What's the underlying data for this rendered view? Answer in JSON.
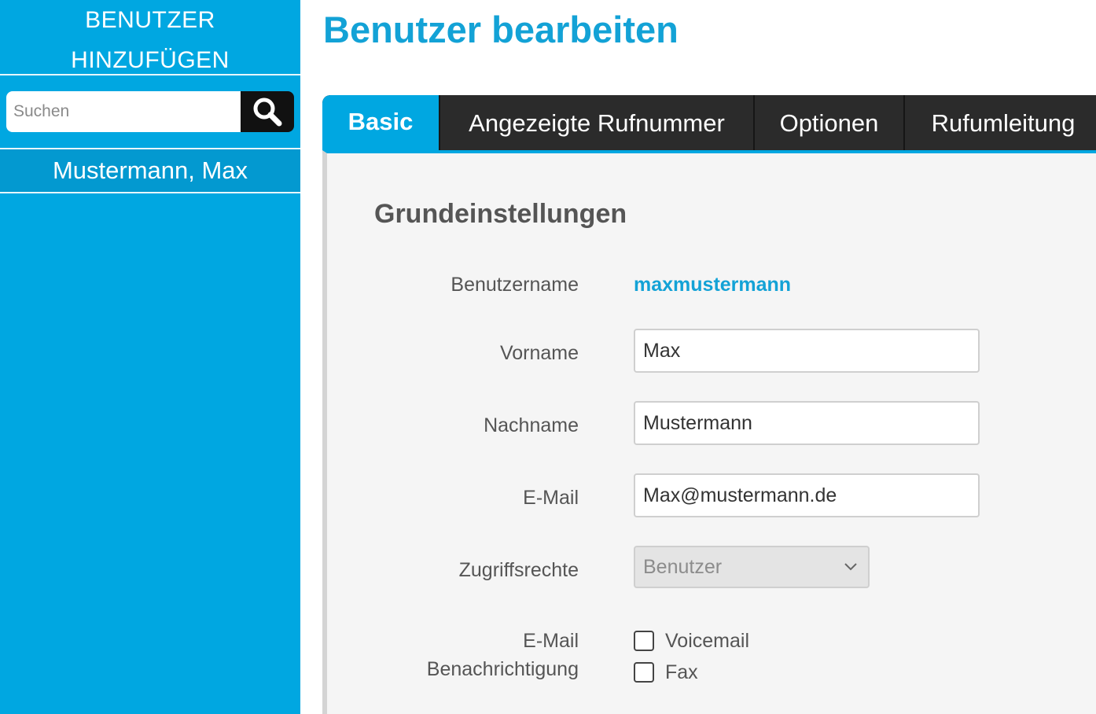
{
  "sidebar": {
    "add_user_line1": "BENUTZER",
    "add_user_line2": "HINZUFÜGEN",
    "search_placeholder": "Suchen",
    "users": [
      "Mustermann, Max"
    ]
  },
  "main": {
    "title": "Benutzer bearbeiten",
    "tabs": [
      {
        "label": "Basic",
        "active": true
      },
      {
        "label": "Angezeigte Rufnummer",
        "active": false
      },
      {
        "label": "Optionen",
        "active": false
      },
      {
        "label": "Rufumleitung",
        "active": false
      }
    ],
    "section_title": "Grundeinstellungen",
    "form": {
      "username_label": "Benutzername",
      "username_value": "maxmustermann",
      "firstname_label": "Vorname",
      "firstname_value": "Max",
      "lastname_label": "Nachname",
      "lastname_value": "Mustermann",
      "email_label": "E-Mail",
      "email_value": "Max@mustermann.de",
      "access_label": "Zugriffsrechte",
      "access_value": "Benutzer",
      "notify_label_line1": "E-Mail",
      "notify_label_line2": "Benachrichtigung",
      "notify_options": [
        {
          "label": "Voicemail",
          "checked": false
        },
        {
          "label": "Fax",
          "checked": false
        }
      ]
    }
  },
  "colors": {
    "accent": "#00a7e1",
    "title": "#13a2d6",
    "tabbar": "#2b2b2b"
  }
}
